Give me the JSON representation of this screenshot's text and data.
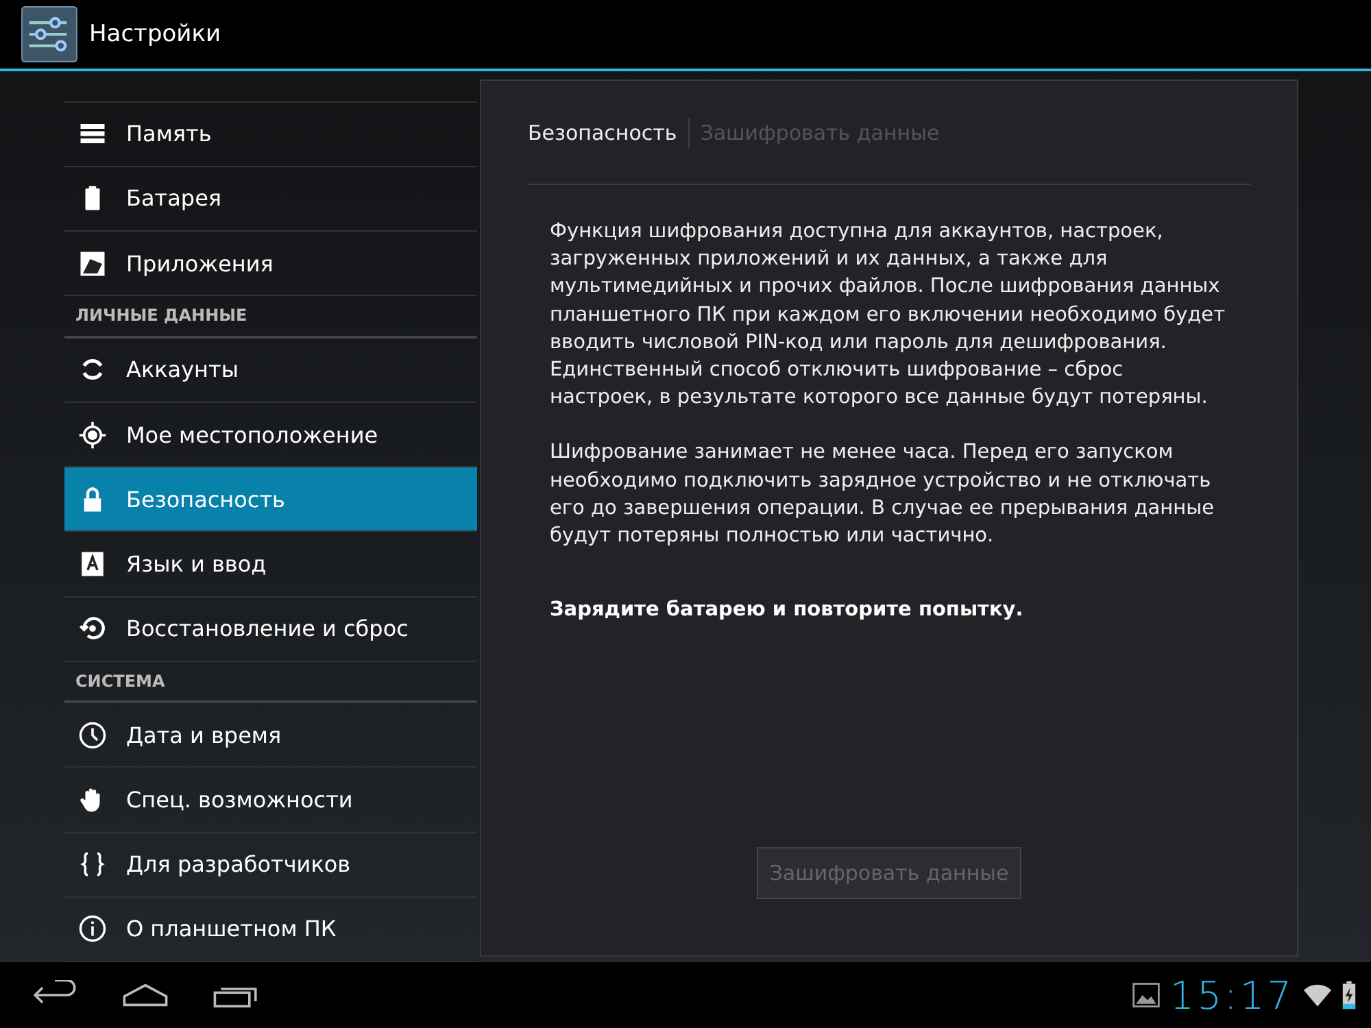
{
  "action_bar": {
    "title": "Настройки"
  },
  "sidebar": {
    "items": [
      {
        "kind": "item",
        "label": "Память",
        "selected": false
      },
      {
        "kind": "item",
        "label": "Батарея",
        "selected": false
      },
      {
        "kind": "item",
        "label": "Приложения",
        "selected": false
      },
      {
        "kind": "header",
        "label": "ЛИЧНЫЕ ДАННЫЕ"
      },
      {
        "kind": "item",
        "label": "Аккаунты",
        "selected": false
      },
      {
        "kind": "item",
        "label": "Мое местоположение",
        "selected": false
      },
      {
        "kind": "item",
        "label": "Безопасность",
        "selected": true
      },
      {
        "kind": "item",
        "label": "Язык и ввод",
        "selected": false
      },
      {
        "kind": "item",
        "label": "Восстановление и сброс",
        "selected": false
      },
      {
        "kind": "header",
        "label": "СИСТЕМА"
      },
      {
        "kind": "item",
        "label": "Дата и время",
        "selected": false
      },
      {
        "kind": "item",
        "label": "Спец. возможности",
        "selected": false
      },
      {
        "kind": "item",
        "label": "Для разработчиков",
        "selected": false
      },
      {
        "kind": "item",
        "label": "О планшетном ПК",
        "selected": false
      }
    ]
  },
  "breadcrumbs": [
    {
      "label": "Безопасность",
      "selected": true
    },
    {
      "label": "Зашифровать данные",
      "selected": false
    }
  ],
  "content": {
    "paragraphs": [
      "Функция шифрования доступна для аккаунтов, настроек, загруженных приложений и их данных, а также для мультимедийных и прочих файлов. После шифрования данных планшетного ПК при каждом его включении необходимо будет вводить числовой PIN-код или пароль для дешифрования. Единственный способ отключить шифрование – сброс настроек, в результате которого все данные будут потеряны.",
      "Шифрование занимает не менее часа. Перед его запуском необходимо подключить зарядное устройство и не отключать его до завершения операции. В случае ее прерывания данные будут потеряны полностью или частично."
    ],
    "warning": "Зарядите батарею и повторите попытку.",
    "button": {
      "label": "Зашифровать данные",
      "disabled": true
    }
  },
  "nav_bar": {
    "time": "15:17"
  }
}
